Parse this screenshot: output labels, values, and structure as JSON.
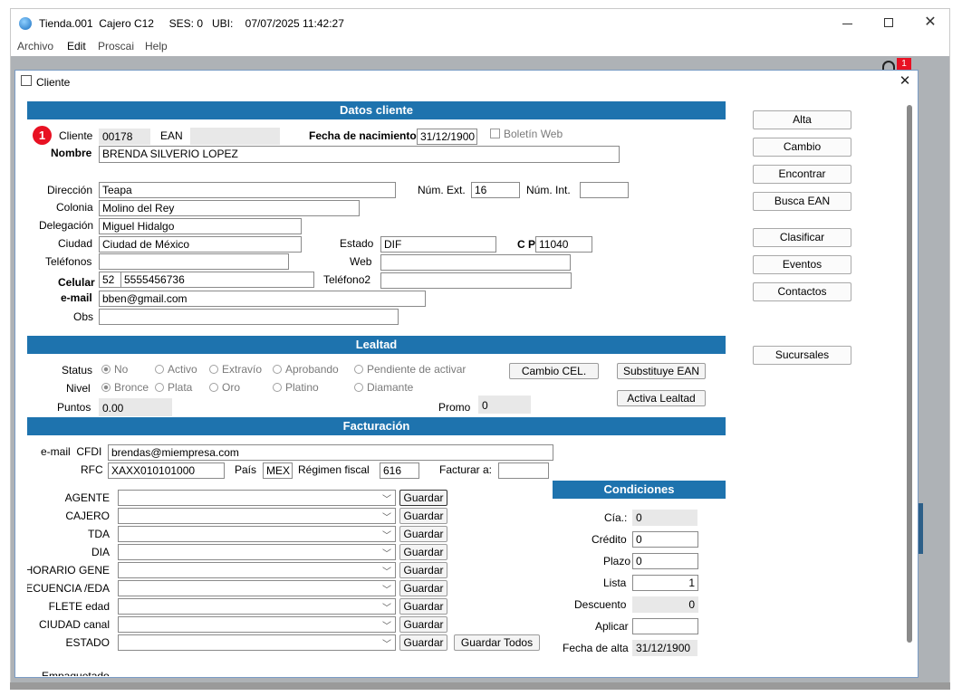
{
  "window": {
    "title": "Tienda.001  Cajero C12     SES: 0   UBI:    07/07/2025 11:42:27",
    "notif_count": "1"
  },
  "menu": [
    "Archivo",
    "Edit",
    "Proscai",
    "Help"
  ],
  "dialog": {
    "title": "Cliente",
    "badge": "1"
  },
  "sections": {
    "datos": "Datos cliente",
    "lealtad": "Lealtad",
    "facturacion": "Facturación",
    "condiciones": "Condiciones"
  },
  "cliente": {
    "label": "Cliente",
    "value": "00178",
    "ean_label": "EAN",
    "ean_value": "",
    "fnac_label": "Fecha de nacimiento",
    "fnac_value": "31/12/1900",
    "boletin_label": "Boletín Web",
    "nombre_label": "Nombre",
    "nombre_value": "BRENDA SILVERIO LOPEZ",
    "direccion_label": "Dirección",
    "direccion_value": "Teapa",
    "numext_label": "Núm. Ext.",
    "numext_value": "16",
    "numint_label": "Núm. Int.",
    "numint_value": "",
    "colonia_label": "Colonia",
    "colonia_value": "Molino del Rey",
    "delegacion_label": "Delegación",
    "delegacion_value": "Miguel Hidalgo",
    "ciudad_label": "Ciudad",
    "ciudad_value": "Ciudad de México",
    "estado_label": "Estado",
    "estado_value": "DIF",
    "cp_label": "C P",
    "cp_value": "11040",
    "telefonos_label": "Teléfonos",
    "telefonos_value": "",
    "web_label": "Web",
    "web_value": "",
    "celular_label": "Celular",
    "celular_lada": "52",
    "celular_value": "5555456736",
    "telefono2_label": "Teléfono2",
    "telefono2_value": "",
    "email_label": "e-mail",
    "email_value": "bben@gmail.com",
    "obs_label": "Obs",
    "obs_value": ""
  },
  "lealtad": {
    "status_label": "Status",
    "status_options": [
      "No",
      "Activo",
      "Extravío",
      "Aprobando",
      "Pendiente de activar"
    ],
    "nivel_label": "Nivel",
    "nivel_options": [
      "Bronce",
      "Plata",
      "Oro",
      "Platino",
      "Diamante"
    ],
    "puntos_label": "Puntos",
    "puntos_value": "0.00",
    "promo_label": "Promo",
    "promo_value": "0",
    "cambio_cel": "Cambio CEL.",
    "substituye_ean": "Substituye EAN",
    "activa_lealtad": "Activa Lealtad"
  },
  "facturacion": {
    "email_label": "e-mail  CFDI",
    "email_value": "brendas@miempresa.com",
    "rfc_label": "RFC",
    "rfc_value": "XAXX010101000",
    "pais_label": "País",
    "pais_value": "MEX",
    "regimen_label": "Régimen fiscal",
    "regimen_value": "616",
    "facturar_label": "Facturar a:",
    "facturar_value": "",
    "guardar": "Guardar",
    "guardar_todos": "Guardar Todos",
    "combos": [
      "AGENTE",
      "CAJERO",
      "TDA",
      "DIA",
      "HORARIO GENE",
      "FRECUENCIA /EDA",
      "FLETE edad",
      "CIUDAD canal",
      "ESTADO"
    ],
    "empaquetado": "Empaquetado"
  },
  "condiciones": {
    "cia_label": "Cía.:",
    "cia_value": "0",
    "credito_label": "Crédito",
    "credito_value": "0",
    "plazo_label": "Plazo",
    "plazo_value": "0",
    "lista_label": "Lista",
    "lista_value": "1",
    "descuento_label": "Descuento",
    "descuento_value": "0",
    "aplicar_label": "Aplicar",
    "aplicar_value": "",
    "fecha_alta_label": "Fecha de alta",
    "fecha_alta_value": "31/12/1900"
  },
  "actions": {
    "alta": "Alta",
    "cambio": "Cambio",
    "encontrar": "Encontrar",
    "busca_ean": "Busca EAN",
    "clasificar": "Clasificar",
    "eventos": "Eventos",
    "contactos": "Contactos",
    "sucursales": "Sucursales"
  },
  "colors": {
    "section_bar": "#1e73ae",
    "badge": "#e81123"
  }
}
